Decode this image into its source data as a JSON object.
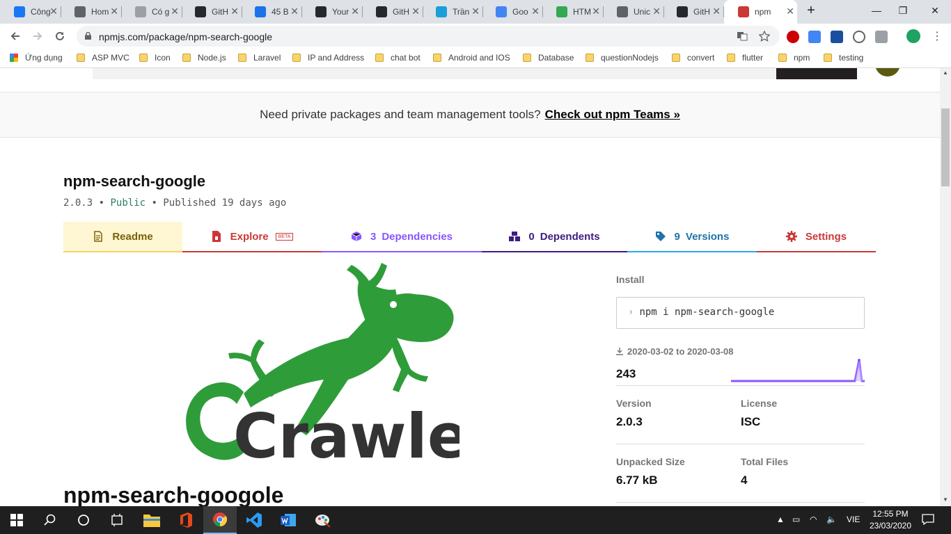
{
  "browser": {
    "tabs": [
      {
        "title": "Công",
        "color": "#1877f2"
      },
      {
        "title": "Hom",
        "color": "#5f6368"
      },
      {
        "title": "Có g",
        "color": "#9aa0a6"
      },
      {
        "title": "GitH",
        "color": "#24292e"
      },
      {
        "title": "45 B",
        "color": "#1a73e8"
      },
      {
        "title": "Your",
        "color": "#24292e"
      },
      {
        "title": "GitH",
        "color": "#24292e"
      },
      {
        "title": "Trần",
        "color": "#1a9fd8"
      },
      {
        "title": "Goo",
        "color": "#4285f4"
      },
      {
        "title": "HTM",
        "color": "#34a853"
      },
      {
        "title": "Unic",
        "color": "#5f6368"
      },
      {
        "title": "GitH",
        "color": "#24292e"
      },
      {
        "title": "npm",
        "color": "#cb3837"
      }
    ],
    "new_tab": "+",
    "window_controls": {
      "minimize": "—",
      "maximize": "❐",
      "close": "✕"
    },
    "url": "npmjs.com/package/npm-search-google",
    "bookmarks": [
      "Ứng dụng",
      "ASP MVC",
      "Icon",
      "Node.js",
      "Laravel",
      "IP and Address",
      "chat bot",
      "Android and IOS",
      "Database",
      "questionNodejs",
      "convert",
      "flutter",
      "npm",
      "testing"
    ]
  },
  "page": {
    "banner_text": "Need private packages and team management tools?",
    "banner_link": "Check out npm Teams »",
    "package_name": "npm-search-google",
    "version_line": "2.0.3",
    "visibility": "Public",
    "published": "Published 19 days ago",
    "bullet": "•",
    "tabs": {
      "readme": "Readme",
      "explore": "Explore",
      "beta": "BETA",
      "dependencies_count": "3",
      "dependencies": "Dependencies",
      "dependents_count": "0",
      "dependents": "Dependents",
      "versions_count": "9",
      "versions": "Versions",
      "settings": "Settings"
    },
    "readme_heading": "npm-search-googole",
    "logo_text": "Crawler",
    "sidebar": {
      "install_label": "Install",
      "install_prompt": "›",
      "install_cmd": "npm i npm-search-google",
      "download_range": "2020-03-02 to 2020-03-08",
      "weekly_downloads": "243",
      "version_label": "Version",
      "version_value": "2.0.3",
      "license_label": "License",
      "license_value": "ISC",
      "unpacked_label": "Unpacked Size",
      "unpacked_value": "6.77 kB",
      "files_label": "Total Files",
      "files_value": "4"
    }
  },
  "taskbar": {
    "lang": "VIE",
    "time": "12:55 PM",
    "date": "23/03/2020"
  },
  "colors": {
    "readme_tab": "#fff6d3",
    "readme_text": "#7a6108",
    "explore": "#cb3837",
    "dependencies": "#8956ff",
    "dependents": "#3e1c82",
    "versions": "#29abe2",
    "settings": "#cb3837",
    "gecko": "#2f9c3a",
    "sparkline": "#8956ff"
  }
}
